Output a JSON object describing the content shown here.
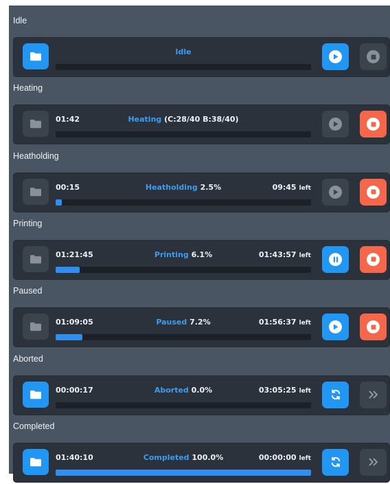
{
  "colors": {
    "panel": "#4a5563",
    "card": "#2b323c",
    "accent_blue": "#2196f3",
    "stop_red": "#f4674a",
    "disabled": "#3b434d",
    "status_word": "#3d9cf0"
  },
  "common": {
    "left_suffix": "left"
  },
  "sections": [
    {
      "title": "Idle",
      "status_word": "Idle",
      "status_value": "",
      "elapsed": "",
      "remaining": "",
      "progress": 0,
      "folder_enabled": true,
      "primary": {
        "icon": "play-icon",
        "style": "blue"
      },
      "secondary": {
        "icon": "stop-icon",
        "style": "disabled"
      }
    },
    {
      "title": "Heating",
      "status_word": "Heating",
      "status_value": "(C:28/40 B:38/40)",
      "elapsed": "01:42",
      "remaining": "",
      "progress": 0,
      "folder_enabled": false,
      "primary": {
        "icon": "play-icon",
        "style": "disabled"
      },
      "secondary": {
        "icon": "stop-icon",
        "style": "red"
      }
    },
    {
      "title": "Heatholding",
      "status_word": "Heatholding",
      "status_value": "2.5%",
      "elapsed": "00:15",
      "remaining": "09:45",
      "progress": 0.025,
      "folder_enabled": false,
      "primary": {
        "icon": "play-icon",
        "style": "disabled"
      },
      "secondary": {
        "icon": "stop-icon",
        "style": "red"
      }
    },
    {
      "title": "Printing",
      "status_word": "Printing",
      "status_value": "6.1%",
      "elapsed": "01:21:45",
      "remaining": "01:43:57",
      "progress": 0.061,
      "folder_enabled": false,
      "primary": {
        "icon": "pause-icon",
        "style": "blue"
      },
      "secondary": {
        "icon": "stop-icon",
        "style": "red"
      }
    },
    {
      "title": "Paused",
      "status_word": "Paused",
      "status_value": "7.2%",
      "elapsed": "01:09:05",
      "remaining": "01:56:37",
      "progress": 0.072,
      "folder_enabled": false,
      "primary": {
        "icon": "play-icon",
        "style": "blue"
      },
      "secondary": {
        "icon": "stop-icon",
        "style": "red"
      }
    },
    {
      "title": "Aborted",
      "status_word": "Aborted",
      "status_value": "0.0%",
      "elapsed": "00:00:17",
      "remaining": "03:05:25",
      "progress": 0,
      "folder_enabled": true,
      "primary": {
        "icon": "reprint-icon",
        "style": "blue"
      },
      "secondary": {
        "icon": "skip-icon",
        "style": "disabled"
      }
    },
    {
      "title": "Completed",
      "status_word": "Completed",
      "status_value": "100.0%",
      "elapsed": "01:40:10",
      "remaining": "00:00:00",
      "progress": 1.0,
      "folder_enabled": true,
      "primary": {
        "icon": "reprint-icon",
        "style": "blue"
      },
      "secondary": {
        "icon": "skip-icon",
        "style": "disabled"
      }
    }
  ]
}
